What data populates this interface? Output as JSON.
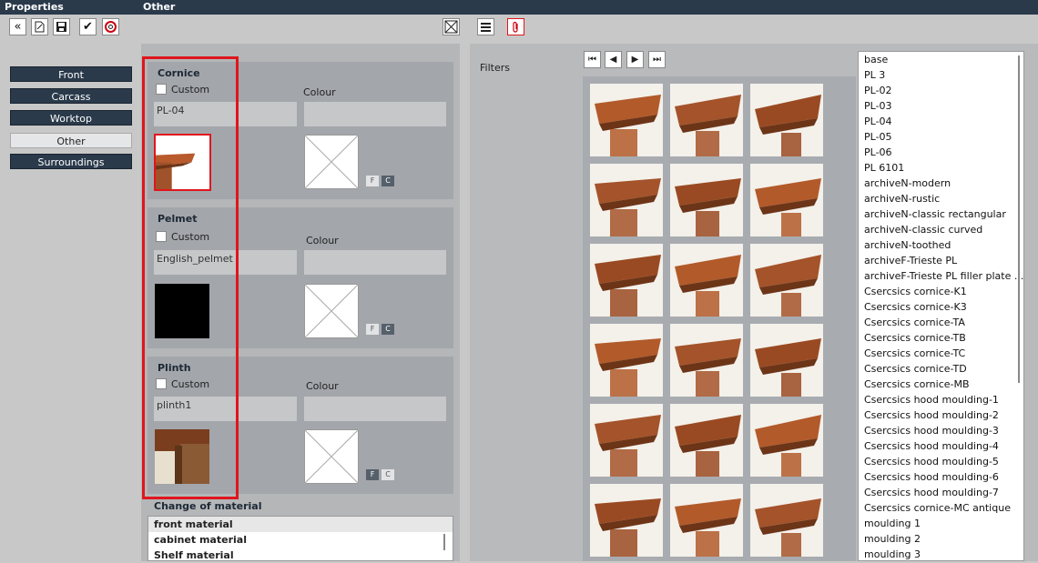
{
  "header": {
    "left_title": "Properties",
    "right_title": "Other"
  },
  "toolbar": {
    "icons": [
      "back-icon",
      "edit-icon",
      "save-icon",
      "check-icon",
      "help-icon",
      "close-box-icon",
      "menu-icon",
      "paperclip-icon"
    ]
  },
  "nav": {
    "items": [
      {
        "label": "Front",
        "active": false
      },
      {
        "label": "Carcass",
        "active": false
      },
      {
        "label": "Worktop",
        "active": false
      },
      {
        "label": "Other",
        "active": true
      },
      {
        "label": "Surroundings",
        "active": false
      }
    ]
  },
  "groups": [
    {
      "title": "Cornice",
      "custom_label": "Custom",
      "colour_label": "Colour",
      "material": "PL-04",
      "fc_active": "C"
    },
    {
      "title": "Pelmet",
      "custom_label": "Custom",
      "colour_label": "Colour",
      "material": "English_pelmet",
      "fc_active": "C"
    },
    {
      "title": "Plinth",
      "custom_label": "Custom",
      "colour_label": "Colour",
      "material": "plinth1",
      "fc_active": "F"
    }
  ],
  "fc_labels": {
    "f": "F",
    "c": "C"
  },
  "materials": {
    "title": "Change of material",
    "items": [
      "front material",
      "cabinet material",
      "Shelf material"
    ],
    "selected_index": 0
  },
  "filters_label": "Filters",
  "colors": {
    "nav_bg": "#2a3a4b",
    "highlight": "#e0161d"
  },
  "list": {
    "items": [
      "base",
      "PL 3",
      "PL-02",
      "PL-03",
      "PL-04",
      "PL-05",
      "PL-06",
      "PL 6101",
      "archiveN-modern",
      "archiveN-rustic",
      "archiveN-classic rectangular",
      "archiveN-classic curved",
      "archiveN-toothed",
      "archiveF-Trieste PL",
      "archiveF-Trieste PL filler plate ...",
      "Csercsics cornice-K1",
      "Csercsics cornice-K3",
      "Csercsics cornice-TA",
      "Csercsics cornice-TB",
      "Csercsics cornice-TC",
      "Csercsics cornice-TD",
      "Csercsics cornice-MB",
      "Csercsics hood moulding-1",
      "Csercsics hood moulding-2",
      "Csercsics hood moulding-3",
      "Csercsics hood moulding-4",
      "Csercsics hood moulding-5",
      "Csercsics hood moulding-6",
      "Csercsics hood moulding-7",
      "Csercsics cornice-MC antique",
      "moulding 1",
      "moulding 2",
      "moulding 3"
    ]
  }
}
